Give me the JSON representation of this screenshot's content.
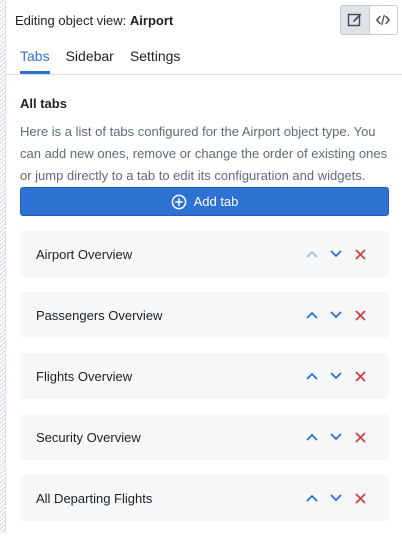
{
  "header": {
    "prefix": "Editing object view: ",
    "object_name": "Airport",
    "toggle": {
      "edit_icon": "edit-icon",
      "code_icon": "code-icon"
    }
  },
  "tabs": [
    {
      "label": "Tabs",
      "active": true
    },
    {
      "label": "Sidebar",
      "active": false
    },
    {
      "label": "Settings",
      "active": false
    }
  ],
  "section": {
    "title": "All tabs",
    "description": "Here is a list of tabs configured for the Airport object type. You can add new ones, remove or change the order of existing ones or jump directly to a tab to edit its configuration and widgets."
  },
  "add_button": {
    "label": "Add tab",
    "icon": "plus-circle-icon"
  },
  "tab_list": [
    {
      "label": "Airport Overview",
      "move_up_disabled": true
    },
    {
      "label": "Passengers Overview",
      "move_up_disabled": false
    },
    {
      "label": "Flights Overview",
      "move_up_disabled": false
    },
    {
      "label": "Security Overview",
      "move_up_disabled": false
    },
    {
      "label": "All Departing Flights",
      "move_up_disabled": false
    }
  ],
  "colors": {
    "accent": "#2d72d2",
    "remove": "#cd4246",
    "row_bg": "#f6f7f9",
    "muted_text": "#5f6b7c"
  }
}
